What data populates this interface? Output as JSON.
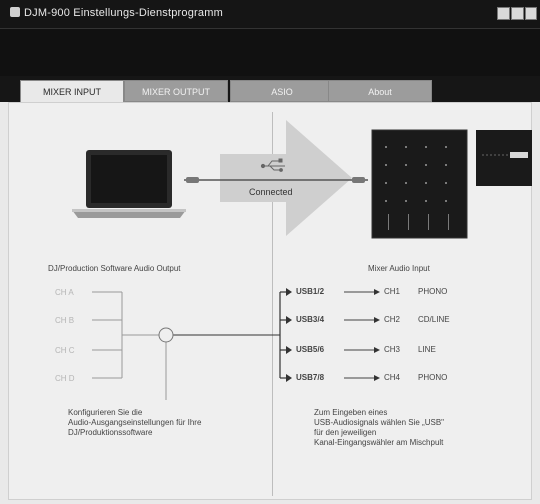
{
  "window": {
    "title": "DJM-900 Einstellungs-Dienstprogramm",
    "colors": {
      "titlebar": "#151515",
      "tab_inactive": "#9c9c9c",
      "content_bg": "#efefef",
      "arrow": "#cfcfcf",
      "device": "#1a1a1a"
    }
  },
  "tabs": [
    {
      "label": "MIXER INPUT",
      "active": true
    },
    {
      "label": "MIXER OUTPUT",
      "active": false
    },
    {
      "label": "ASIO",
      "active": false
    },
    {
      "label": "About",
      "active": false
    }
  ],
  "connection": {
    "status": "Connected",
    "usb_icon": "usb-icon"
  },
  "left": {
    "heading": "DJ/Production Software Audio Output",
    "channels": [
      "CH A",
      "CH B",
      "CH C",
      "CH D"
    ],
    "description": [
      "Konfigurieren Sie die",
      "Audio-Ausgangseinstellungen für Ihre",
      "DJ/Produktionssoftware"
    ]
  },
  "right": {
    "heading": "Mixer Audio Input",
    "routes": [
      {
        "usb": "USB1/2",
        "channel": "CH1",
        "source": "PHONO"
      },
      {
        "usb": "USB3/4",
        "channel": "CH2",
        "source": "CD/LINE"
      },
      {
        "usb": "USB5/6",
        "channel": "CH3",
        "source": "LINE"
      },
      {
        "usb": "USB7/8",
        "channel": "CH4",
        "source": "PHONO"
      }
    ],
    "description": [
      "Zum Eingeben eines",
      "USB-Audiosignals wählen Sie „USB\"",
      "für den jeweiligen",
      "Kanal-Eingangswähler am Mischpult"
    ]
  }
}
